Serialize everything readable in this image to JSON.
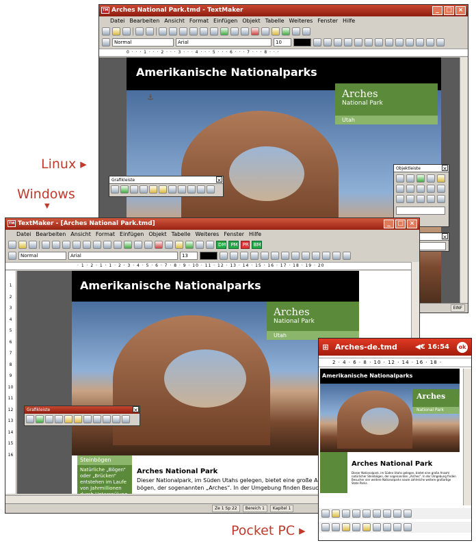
{
  "labels": {
    "linux": "Linux ▸",
    "windows": "Windows",
    "windows_arrow": "▼",
    "pocket": "Pocket PC ▸"
  },
  "linux": {
    "title": "Arches National Park.tmd - TextMaker",
    "menu": [
      "Datei",
      "Bearbeiten",
      "Ansicht",
      "Format",
      "Einfügen",
      "Objekt",
      "Tabelle",
      "Weiteres",
      "Fenster",
      "Hilfe"
    ],
    "style": "Normal",
    "font": "Arial",
    "size": "10",
    "ruler": "0 · · · 1 · · · 2 · · · 3 · · · 4 · · · 5 · · · 6 · · · 7 · · · 8 · · ·",
    "heading": "Amerikanische Nationalparks",
    "box_title": "Arches",
    "box_sub": "National Park",
    "box_state": "Utah",
    "grafik_title": "Grafikleiste",
    "objekt_title": "Objektleiste",
    "ter": "ter",
    "einf": "EINF"
  },
  "windows": {
    "title": "TextMaker - [Arches National Park.tmd]",
    "menu": [
      "Datei",
      "Bearbeiten",
      "Ansicht",
      "Format",
      "Einfügen",
      "Objekt",
      "Tabelle",
      "Weiteres",
      "Fenster",
      "Hilfe"
    ],
    "badges": [
      "DM",
      "PM",
      "PR",
      "BM"
    ],
    "style": "Normal",
    "font": "Arial",
    "size": "13",
    "ruler": "· 1 · 2 · 1 · 1 · 2 · 3 · 4 · 5 · 6 · 7 · 8 · 9 · 10 · 11 · 12 · 13 · 14 · 15 · 16 · 17 · 18 · 19 · 20",
    "heading": "Amerikanische Nationalparks",
    "box_title": "Arches",
    "box_sub": "National Park",
    "box_state": "Utah",
    "grafik_title": "Grafikleiste",
    "side_title": "Steinbögen",
    "side_text": "Natürliche „Bögen“ oder „Brücken“ entstehen im Laufe von Jahrmillionen durch Unterspülung",
    "article_title": "Arches National Park",
    "article_text1": "Dieser Nationalpark, im Süden Utahs gelegen, bietet eine große Anzahl natü",
    "article_text2": "bögen, der sogenannten „Arches“. In der Umgebung finden Besucher vier we",
    "vruler": [
      "1",
      "2",
      "3",
      "4",
      "5",
      "6",
      "7",
      "8",
      "9",
      "10",
      "11",
      "12",
      "13",
      "14",
      "15",
      "16"
    ],
    "status": [
      "Ze 1 Sp 22",
      "Bereich 1",
      "Kapitel 1"
    ]
  },
  "pocket": {
    "title": "Arches-de.tmd",
    "clock": "◀€ 16:54",
    "ok": "ok",
    "ruler": "2 · 4 · 6 · 8 · 10 · 12 · 14 · 16 · 18 ·",
    "heading": "Amerikanische Nationalparks",
    "box_title": "Arches",
    "box_sub": "National Park",
    "article_title": "Arches National Park",
    "article_text": "Dieser Nationalpark, im Süden Utahs gelegen, bietet eine große Anzahl natürlicher Steinbögen, der sogenannten „Arches“. In der Umgebung finden Besucher vier weitere Nationalparks sowie zahlreiche weitere großartige State Parks."
  },
  "colors": {
    "accent": "#c0392b",
    "green": "#5a8a3a",
    "green_light": "#8bb56a"
  }
}
